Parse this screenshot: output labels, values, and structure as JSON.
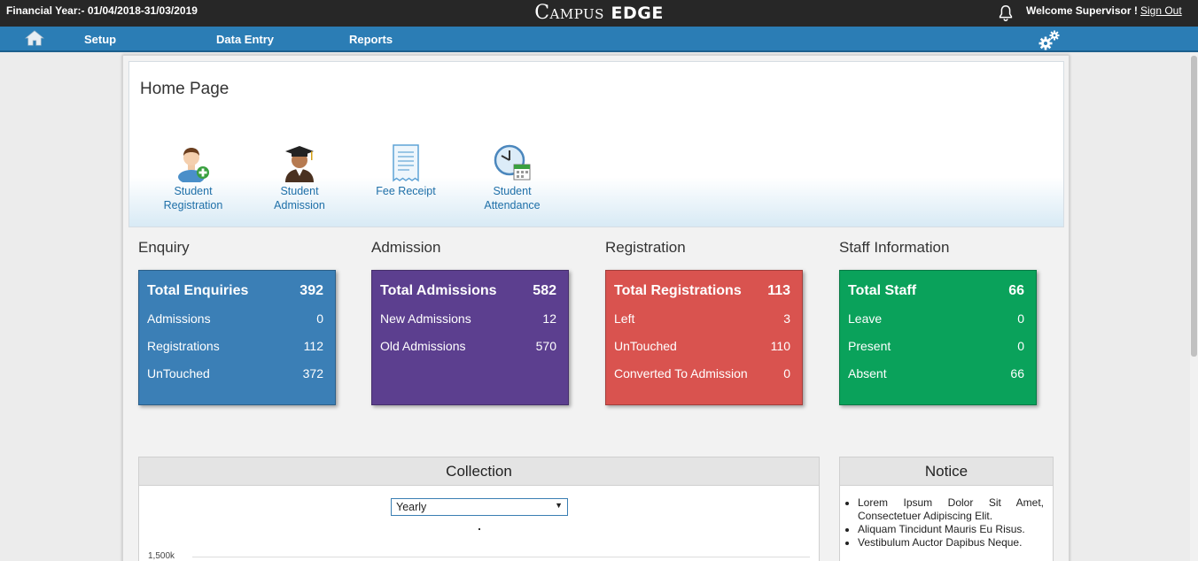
{
  "header": {
    "financial_year": "Financial Year:- 01/04/2018-31/03/2019",
    "brand_main": "Campus",
    "brand_sub": "EDGE",
    "welcome": "Welcome Supervisor !",
    "sign_out": "Sign Out"
  },
  "nav": {
    "items": [
      {
        "label": "Setup"
      },
      {
        "label": "Data Entry"
      },
      {
        "label": "Reports"
      }
    ]
  },
  "home": {
    "title": "Home Page",
    "quick_links": [
      {
        "line1": "Student",
        "line2": "Registration",
        "icon": "student-registration-icon"
      },
      {
        "line1": "Student",
        "line2": "Admission",
        "icon": "graduate-icon"
      },
      {
        "line1": "Fee Receipt",
        "line2": "",
        "icon": "receipt-icon"
      },
      {
        "line1": "Student",
        "line2": "Attendance",
        "icon": "attendance-clock-icon"
      }
    ]
  },
  "sections": [
    {
      "title": "Enquiry",
      "color": "#3b7fb6",
      "head": {
        "label": "Total Enquiries",
        "value": "392"
      },
      "rows": [
        {
          "label": "Admissions",
          "value": "0"
        },
        {
          "label": "Registrations",
          "value": "112"
        },
        {
          "label": "UnTouched",
          "value": "372"
        }
      ]
    },
    {
      "title": "Admission",
      "color": "#5c3f8f",
      "head": {
        "label": "Total Admissions",
        "value": "582"
      },
      "rows": [
        {
          "label": "New Admissions",
          "value": "12"
        },
        {
          "label": "Old Admissions",
          "value": "570"
        }
      ]
    },
    {
      "title": "Registration",
      "color": "#d9534f",
      "head": {
        "label": "Total Registrations",
        "value": "113"
      },
      "rows": [
        {
          "label": "Left",
          "value": "3"
        },
        {
          "label": "UnTouched",
          "value": "110"
        },
        {
          "label": "Converted To Admission",
          "value": "0"
        }
      ]
    },
    {
      "title": "Staff Information",
      "color": "#0aa25b",
      "head": {
        "label": "Total Staff",
        "value": "66"
      },
      "rows": [
        {
          "label": "Leave",
          "value": "0"
        },
        {
          "label": "Present",
          "value": "0"
        },
        {
          "label": "Absent",
          "value": "66"
        }
      ]
    }
  ],
  "collection": {
    "title": "Collection",
    "period_selected": "Yearly",
    "y_tick": "1,500k"
  },
  "notice": {
    "title": "Notice",
    "items": [
      "Lorem Ipsum Dolor Sit Amet, Consectetuer Adipiscing Elit.",
      "Aliquam Tincidunt Mauris Eu Risus.",
      "Vestibulum Auctor Dapibus Neque."
    ]
  }
}
